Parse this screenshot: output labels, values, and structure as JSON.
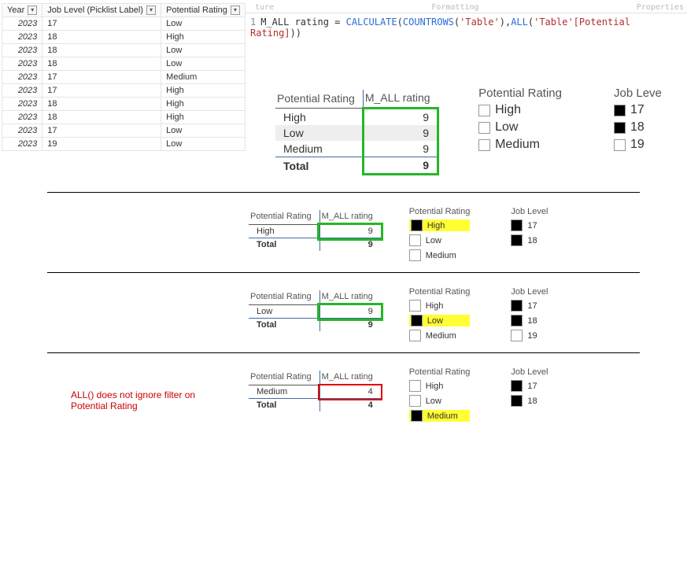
{
  "table_headers": {
    "year": "Year",
    "job": "Job Level (Picklist Label)",
    "pot": "Potential Rating"
  },
  "table_rows": [
    {
      "y": "2023",
      "j": "17",
      "p": "Low"
    },
    {
      "y": "2023",
      "j": "18",
      "p": "High"
    },
    {
      "y": "2023",
      "j": "18",
      "p": "Low"
    },
    {
      "y": "2023",
      "j": "18",
      "p": "Low"
    },
    {
      "y": "2023",
      "j": "17",
      "p": "Medium"
    },
    {
      "y": "2023",
      "j": "17",
      "p": "High"
    },
    {
      "y": "2023",
      "j": "18",
      "p": "High"
    },
    {
      "y": "2023",
      "j": "18",
      "p": "High"
    },
    {
      "y": "2023",
      "j": "17",
      "p": "Low"
    },
    {
      "y": "2023",
      "j": "19",
      "p": "Low"
    }
  ],
  "ribbon": {
    "structure": "ture",
    "formatting": "Formatting",
    "properties": "Properties"
  },
  "formula": {
    "line_no": "1",
    "lhs": "M_ALL rating = ",
    "fn1": "CALCULATE",
    "paren1": "(",
    "fn2": "COUNTROWS",
    "paren2": "(",
    "arg_table": "'Table'",
    "paren2c": ")",
    "comma": ",",
    "fn3": "ALL",
    "paren3": "(",
    "arg_col": "'Table'[Potential Rating]",
    "paren3c": "))",
    "end": ""
  },
  "matrix_headers": {
    "col1": "Potential Rating",
    "col2": "M_ALL rating"
  },
  "main_matrix": {
    "rows": [
      {
        "label": "High",
        "val": "9"
      },
      {
        "label": "Low",
        "val": "9"
      },
      {
        "label": "Medium",
        "val": "9"
      }
    ],
    "total_label": "Total",
    "total_val": "9"
  },
  "main_slicer_pr": {
    "title": "Potential Rating",
    "opts": [
      {
        "label": "High",
        "checked": false
      },
      {
        "label": "Low",
        "checked": false
      },
      {
        "label": "Medium",
        "checked": false
      }
    ]
  },
  "main_slicer_jl": {
    "title": "Job Leve",
    "opts": [
      {
        "label": "17",
        "checked": true
      },
      {
        "label": "18",
        "checked": true
      },
      {
        "label": "19",
        "checked": false
      }
    ]
  },
  "sec_high": {
    "matrix": {
      "rows": [
        {
          "label": "High",
          "val": "9"
        }
      ],
      "total_label": "Total",
      "total_val": "9"
    },
    "pr": {
      "title": "Potential Rating",
      "opts": [
        {
          "label": "High",
          "checked": true,
          "highlight": true
        },
        {
          "label": "Low",
          "checked": false
        },
        {
          "label": "Medium",
          "checked": false
        }
      ]
    },
    "jl": {
      "title": "Job Level",
      "opts": [
        {
          "label": "17",
          "checked": true
        },
        {
          "label": "18",
          "checked": true
        }
      ]
    }
  },
  "sec_low": {
    "matrix": {
      "rows": [
        {
          "label": "Low",
          "val": "9"
        }
      ],
      "total_label": "Total",
      "total_val": "9"
    },
    "pr": {
      "title": "Potential Rating",
      "opts": [
        {
          "label": "High",
          "checked": false
        },
        {
          "label": "Low",
          "checked": true,
          "highlight": true
        },
        {
          "label": "Medium",
          "checked": false
        }
      ]
    },
    "jl": {
      "title": "Job Level",
      "opts": [
        {
          "label": "17",
          "checked": true
        },
        {
          "label": "18",
          "checked": true
        },
        {
          "label": "19",
          "checked": false
        }
      ]
    }
  },
  "sec_med": {
    "note": "ALL() does not ignore filter on Potential Rating",
    "matrix": {
      "rows": [
        {
          "label": "Medium",
          "val": "4"
        }
      ],
      "total_label": "Total",
      "total_val": "4"
    },
    "pr": {
      "title": "Potential Rating",
      "opts": [
        {
          "label": "High",
          "checked": false
        },
        {
          "label": "Low",
          "checked": false
        },
        {
          "label": "Medium",
          "checked": true,
          "highlight": true
        }
      ]
    },
    "jl": {
      "title": "Job Level",
      "opts": [
        {
          "label": "17",
          "checked": true
        },
        {
          "label": "18",
          "checked": true
        }
      ]
    }
  }
}
